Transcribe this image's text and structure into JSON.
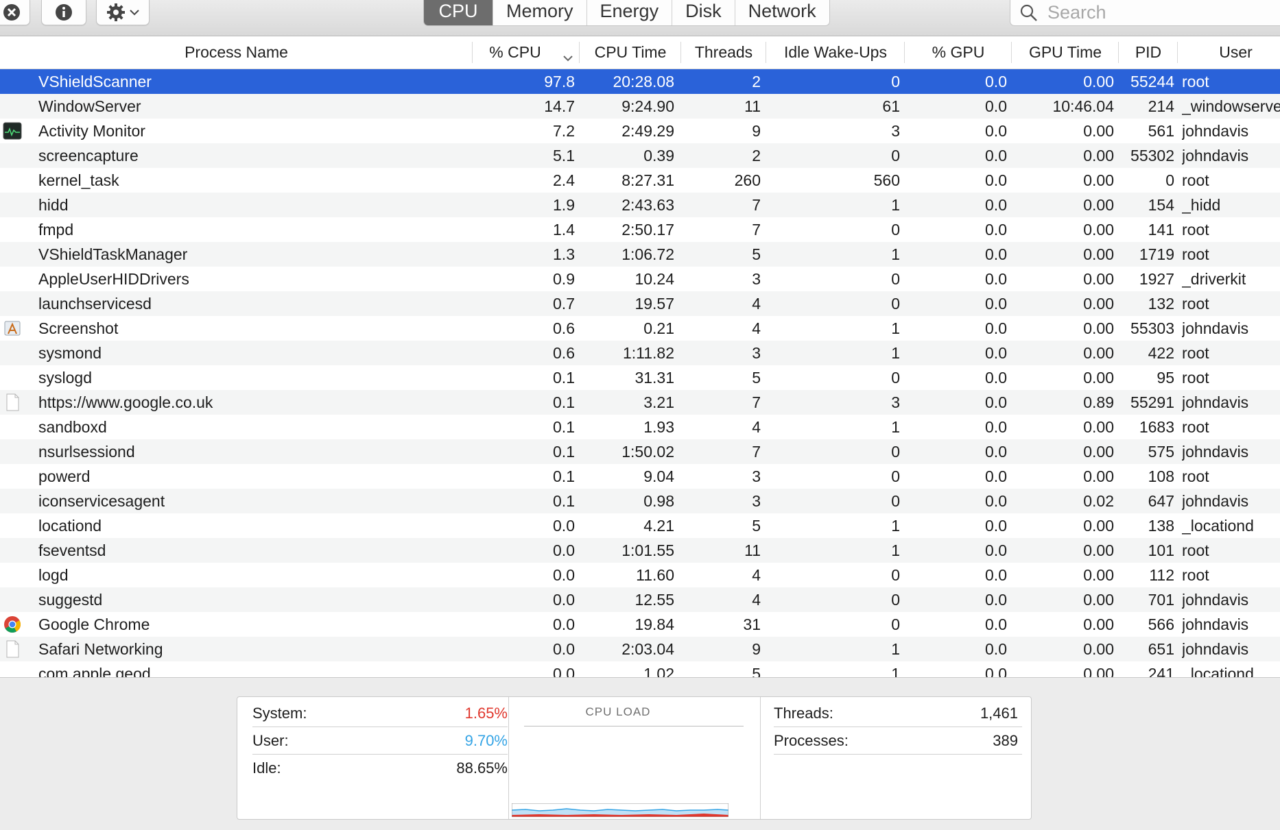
{
  "tabs": [
    {
      "label": "CPU",
      "active": true
    },
    {
      "label": "Memory",
      "active": false
    },
    {
      "label": "Energy",
      "active": false
    },
    {
      "label": "Disk",
      "active": false
    },
    {
      "label": "Network",
      "active": false
    }
  ],
  "search": {
    "placeholder": "Search"
  },
  "columns": {
    "name": "Process Name",
    "cpu": "% CPU",
    "cpu_time": "CPU Time",
    "threads": "Threads",
    "idle": "Idle Wake-Ups",
    "gpu": "% GPU",
    "gpu_time": "GPU Time",
    "pid": "PID",
    "user": "User"
  },
  "processes": [
    {
      "name": "VShieldScanner",
      "cpu": "97.8",
      "cpu_time": "20:28.08",
      "threads": "2",
      "idle": "0",
      "gpu": "0.0",
      "gpu_time": "0.00",
      "pid": "55244",
      "user": "root",
      "icon": "",
      "selected": true
    },
    {
      "name": "WindowServer",
      "cpu": "14.7",
      "cpu_time": "9:24.90",
      "threads": "11",
      "idle": "61",
      "gpu": "0.0",
      "gpu_time": "10:46.04",
      "pid": "214",
      "user": "_windowserver",
      "icon": ""
    },
    {
      "name": "Activity Monitor",
      "cpu": "7.2",
      "cpu_time": "2:49.29",
      "threads": "9",
      "idle": "3",
      "gpu": "0.0",
      "gpu_time": "0.00",
      "pid": "561",
      "user": "johndavis",
      "icon": "activity-monitor-icon"
    },
    {
      "name": "screencapture",
      "cpu": "5.1",
      "cpu_time": "0.39",
      "threads": "2",
      "idle": "0",
      "gpu": "0.0",
      "gpu_time": "0.00",
      "pid": "55302",
      "user": "johndavis",
      "icon": ""
    },
    {
      "name": "kernel_task",
      "cpu": "2.4",
      "cpu_time": "8:27.31",
      "threads": "260",
      "idle": "560",
      "gpu": "0.0",
      "gpu_time": "0.00",
      "pid": "0",
      "user": "root",
      "icon": ""
    },
    {
      "name": "hidd",
      "cpu": "1.9",
      "cpu_time": "2:43.63",
      "threads": "7",
      "idle": "1",
      "gpu": "0.0",
      "gpu_time": "0.00",
      "pid": "154",
      "user": "_hidd",
      "icon": ""
    },
    {
      "name": "fmpd",
      "cpu": "1.4",
      "cpu_time": "2:50.17",
      "threads": "7",
      "idle": "0",
      "gpu": "0.0",
      "gpu_time": "0.00",
      "pid": "141",
      "user": "root",
      "icon": ""
    },
    {
      "name": "VShieldTaskManager",
      "cpu": "1.3",
      "cpu_time": "1:06.72",
      "threads": "5",
      "idle": "1",
      "gpu": "0.0",
      "gpu_time": "0.00",
      "pid": "1719",
      "user": "root",
      "icon": ""
    },
    {
      "name": "AppleUserHIDDrivers",
      "cpu": "0.9",
      "cpu_time": "10.24",
      "threads": "3",
      "idle": "0",
      "gpu": "0.0",
      "gpu_time": "0.00",
      "pid": "1927",
      "user": "_driverkit",
      "icon": ""
    },
    {
      "name": "launchservicesd",
      "cpu": "0.7",
      "cpu_time": "19.57",
      "threads": "4",
      "idle": "0",
      "gpu": "0.0",
      "gpu_time": "0.00",
      "pid": "132",
      "user": "root",
      "icon": ""
    },
    {
      "name": "Screenshot",
      "cpu": "0.6",
      "cpu_time": "0.21",
      "threads": "4",
      "idle": "1",
      "gpu": "0.0",
      "gpu_time": "0.00",
      "pid": "55303",
      "user": "johndavis",
      "icon": "screenshot-app-icon"
    },
    {
      "name": "sysmond",
      "cpu": "0.6",
      "cpu_time": "1:11.82",
      "threads": "3",
      "idle": "1",
      "gpu": "0.0",
      "gpu_time": "0.00",
      "pid": "422",
      "user": "root",
      "icon": ""
    },
    {
      "name": "syslogd",
      "cpu": "0.1",
      "cpu_time": "31.31",
      "threads": "5",
      "idle": "0",
      "gpu": "0.0",
      "gpu_time": "0.00",
      "pid": "95",
      "user": "root",
      "icon": ""
    },
    {
      "name": "https://www.google.co.uk",
      "cpu": "0.1",
      "cpu_time": "3.21",
      "threads": "7",
      "idle": "3",
      "gpu": "0.0",
      "gpu_time": "0.89",
      "pid": "55291",
      "user": "johndavis",
      "icon": "document-icon"
    },
    {
      "name": "sandboxd",
      "cpu": "0.1",
      "cpu_time": "1.93",
      "threads": "4",
      "idle": "1",
      "gpu": "0.0",
      "gpu_time": "0.00",
      "pid": "1683",
      "user": "root",
      "icon": ""
    },
    {
      "name": "nsurlsessiond",
      "cpu": "0.1",
      "cpu_time": "1:50.02",
      "threads": "7",
      "idle": "0",
      "gpu": "0.0",
      "gpu_time": "0.00",
      "pid": "575",
      "user": "johndavis",
      "icon": ""
    },
    {
      "name": "powerd",
      "cpu": "0.1",
      "cpu_time": "9.04",
      "threads": "3",
      "idle": "0",
      "gpu": "0.0",
      "gpu_time": "0.00",
      "pid": "108",
      "user": "root",
      "icon": ""
    },
    {
      "name": "iconservicesagent",
      "cpu": "0.1",
      "cpu_time": "0.98",
      "threads": "3",
      "idle": "0",
      "gpu": "0.0",
      "gpu_time": "0.02",
      "pid": "647",
      "user": "johndavis",
      "icon": ""
    },
    {
      "name": "locationd",
      "cpu": "0.0",
      "cpu_time": "4.21",
      "threads": "5",
      "idle": "1",
      "gpu": "0.0",
      "gpu_time": "0.00",
      "pid": "138",
      "user": "_locationd",
      "icon": ""
    },
    {
      "name": "fseventsd",
      "cpu": "0.0",
      "cpu_time": "1:01.55",
      "threads": "11",
      "idle": "1",
      "gpu": "0.0",
      "gpu_time": "0.00",
      "pid": "101",
      "user": "root",
      "icon": ""
    },
    {
      "name": "logd",
      "cpu": "0.0",
      "cpu_time": "11.60",
      "threads": "4",
      "idle": "0",
      "gpu": "0.0",
      "gpu_time": "0.00",
      "pid": "112",
      "user": "root",
      "icon": ""
    },
    {
      "name": "suggestd",
      "cpu": "0.0",
      "cpu_time": "12.55",
      "threads": "4",
      "idle": "0",
      "gpu": "0.0",
      "gpu_time": "0.00",
      "pid": "701",
      "user": "johndavis",
      "icon": ""
    },
    {
      "name": "Google Chrome",
      "cpu": "0.0",
      "cpu_time": "19.84",
      "threads": "31",
      "idle": "0",
      "gpu": "0.0",
      "gpu_time": "0.00",
      "pid": "566",
      "user": "johndavis",
      "icon": "chrome-icon"
    },
    {
      "name": "Safari Networking",
      "cpu": "0.0",
      "cpu_time": "2:03.04",
      "threads": "9",
      "idle": "1",
      "gpu": "0.0",
      "gpu_time": "0.00",
      "pid": "651",
      "user": "johndavis",
      "icon": "document-icon"
    },
    {
      "name": "com.apple.geod",
      "cpu": "0.0",
      "cpu_time": "1.02",
      "threads": "5",
      "idle": "1",
      "gpu": "0.0",
      "gpu_time": "0.00",
      "pid": "241",
      "user": "_locationd",
      "icon": ""
    }
  ],
  "summary": {
    "system_label": "System:",
    "system_value": "1.65%",
    "user_label": "User:",
    "user_value": "9.70%",
    "idle_label": "Idle:",
    "idle_value": "88.65%",
    "cpu_load_title": "CPU LOAD",
    "threads_label": "Threads:",
    "threads_value": "1,461",
    "processes_label": "Processes:",
    "processes_value": "389"
  },
  "colors": {
    "selection": "#2a62d9",
    "system": "#e0372d",
    "user": "#35a4e5",
    "active_tab": "#6d6d6d"
  }
}
